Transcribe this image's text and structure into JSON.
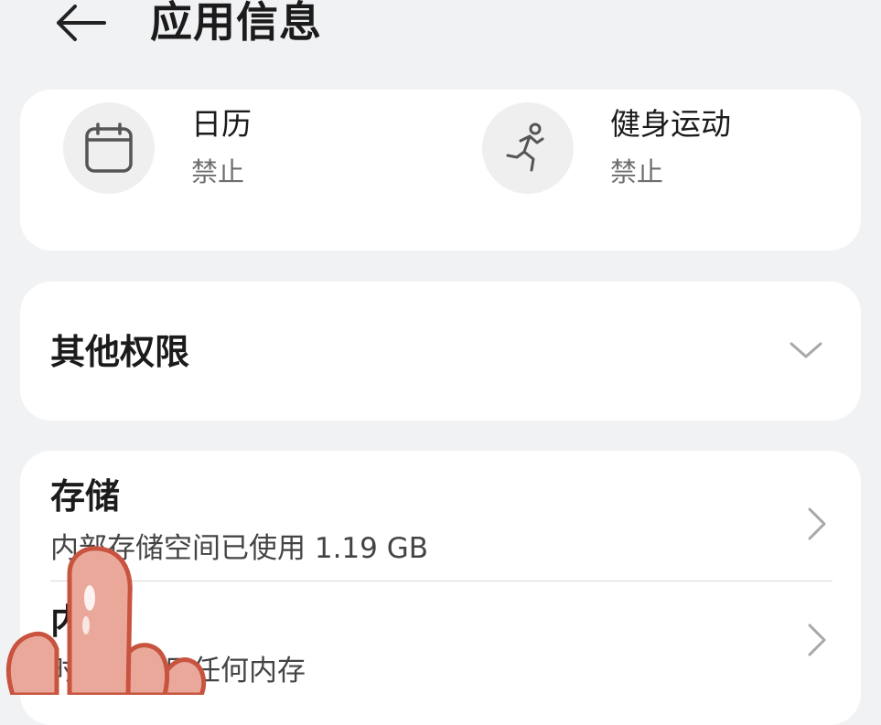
{
  "header": {
    "title": "应用信息",
    "back_icon": "arrow-left-icon"
  },
  "permissions": [
    {
      "name": "日历",
      "status": "禁止",
      "icon": "calendar-icon"
    },
    {
      "name": "健身运动",
      "status": "禁止",
      "icon": "running-person-icon"
    }
  ],
  "other_permissions": {
    "label": "其他权限",
    "icon": "chevron-down-icon"
  },
  "storage": {
    "title": "存储",
    "subtitle": "内部存储空间已使用 1.19 GB"
  },
  "memory": {
    "title": "内",
    "subtitle": "时内未使用任何内存"
  },
  "colors": {
    "background": "#f1f2f4",
    "card": "#ffffff",
    "secondary_text": "#6e6e6e",
    "finger": "#e9a89a"
  }
}
